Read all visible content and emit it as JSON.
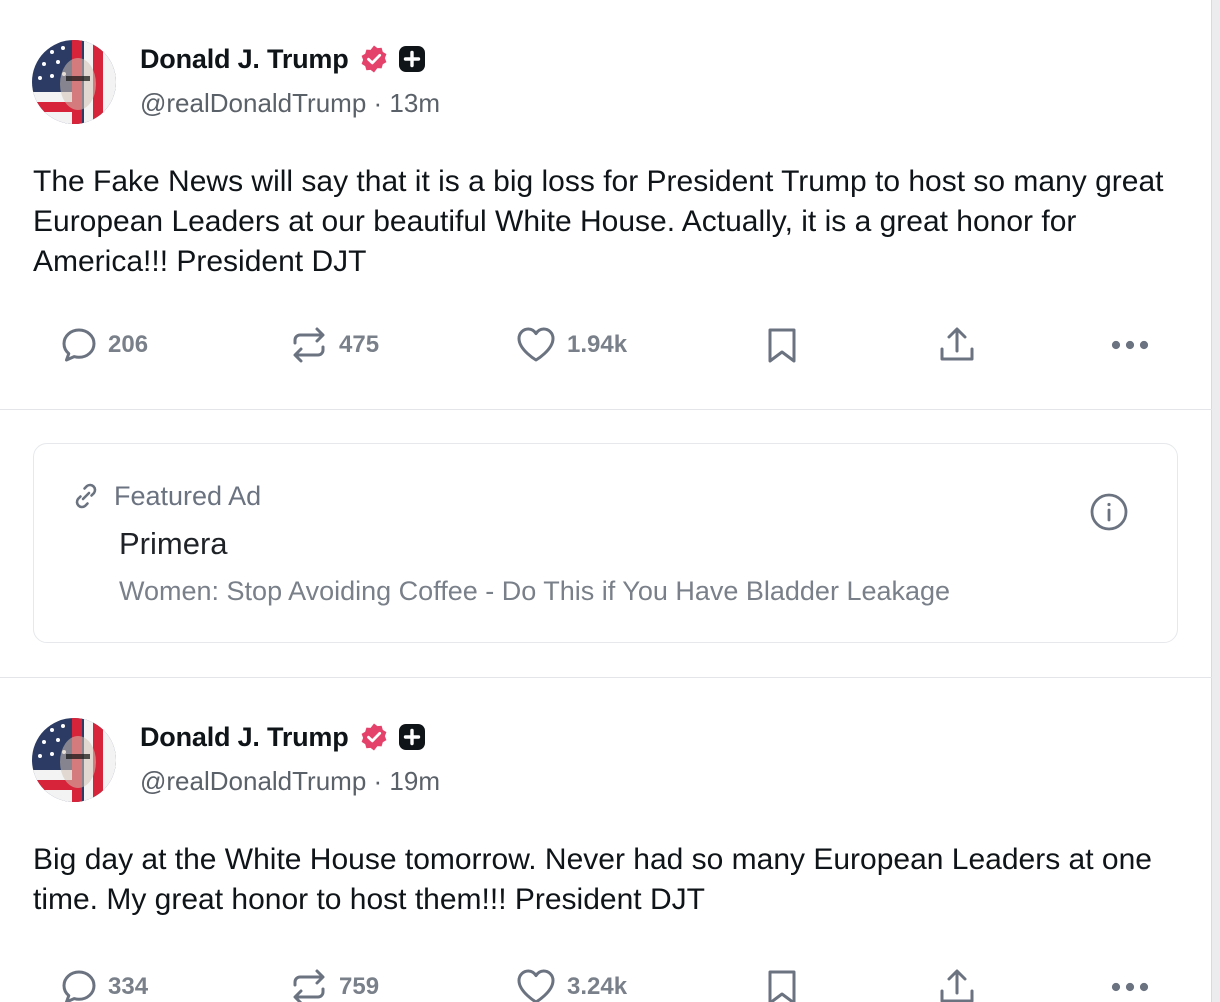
{
  "posts": [
    {
      "author_name": "Donald J. Trump",
      "handle": "@realDonaldTrump",
      "time": "13m",
      "text": "The Fake News will say that it is a big loss for President Trump to host so many great European Leaders at our beautiful White House. Actually, it is a great honor for America!!! President DJT",
      "replies": "206",
      "reposts": "475",
      "likes": "1.94k"
    },
    {
      "author_name": "Donald J. Trump",
      "handle": "@realDonaldTrump",
      "time": "19m",
      "text": "Big day at the White House tomorrow. Never had so many European Leaders at one time. My great honor to host them!!! President DJT",
      "replies": "334",
      "reposts": "759",
      "likes": "3.24k"
    }
  ],
  "ad": {
    "label": "Featured Ad",
    "sponsor": "Primera",
    "headline": "Women: Stop Avoiding Coffee - Do This if You Have Bladder Leakage"
  },
  "separator": " · ",
  "icons": {
    "verified": "verified-badge-icon",
    "plus": "plus-badge-icon",
    "reply": "reply-icon",
    "repost": "repost-icon",
    "like": "heart-icon",
    "bookmark": "bookmark-icon",
    "share": "share-icon",
    "more": "more-icon",
    "link": "link-icon",
    "info": "info-icon"
  },
  "colors": {
    "verified_badge": "#e5426b",
    "text_primary": "#0f1419",
    "text_secondary": "#5b6169",
    "icon_gray": "#6b7280"
  }
}
